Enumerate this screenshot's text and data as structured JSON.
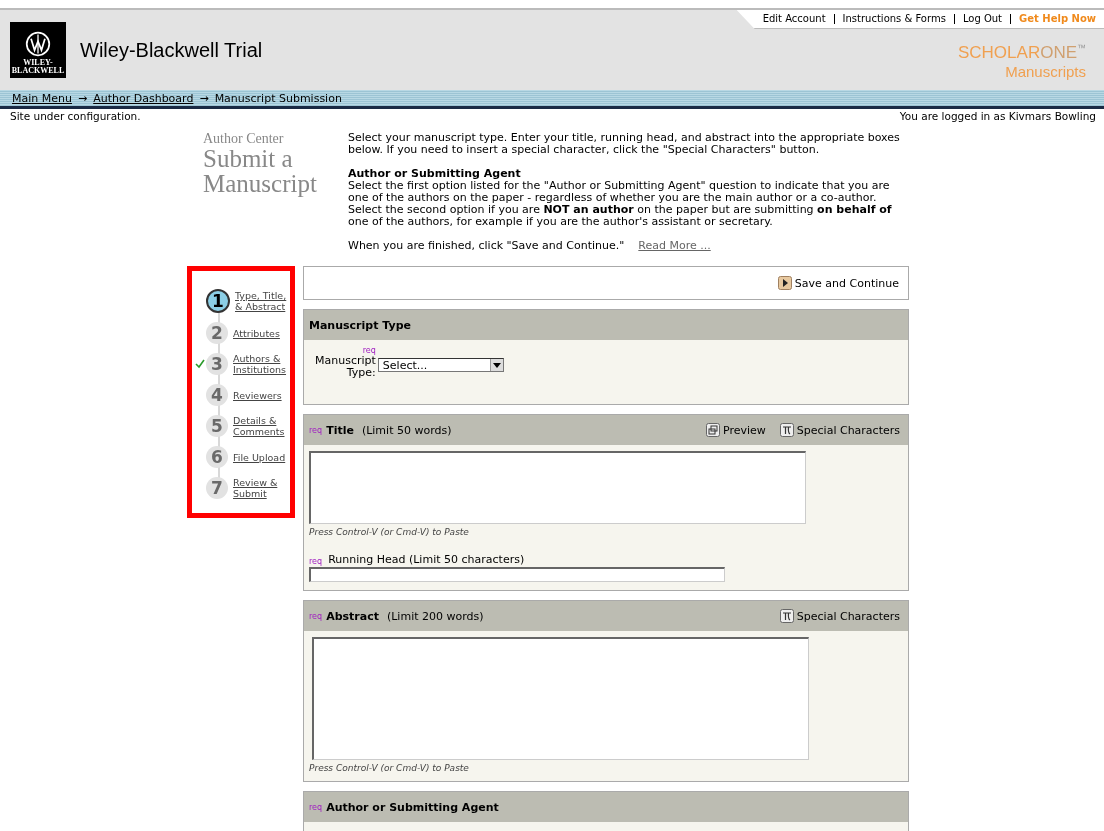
{
  "header": {
    "logo_lines": [
      "WILEY-",
      "BLACKWELL"
    ],
    "site_title": "Wiley-Blackwell Trial",
    "top_links": [
      {
        "label": "Edit Account",
        "kind": "normal"
      },
      {
        "label": "Instructions & Forms",
        "kind": "normal"
      },
      {
        "label": "Log Out",
        "kind": "normal"
      },
      {
        "label": "Get Help Now",
        "kind": "help"
      }
    ],
    "brand": {
      "part_a": "SCHOLAR",
      "part_b": "ONE",
      "tm": "™",
      "product": "Manuscripts"
    }
  },
  "breadcrumb": [
    {
      "label": "Main Menu",
      "link": true
    },
    {
      "label": "Author Dashboard",
      "link": true
    },
    {
      "label": "Manuscript Submission",
      "link": false
    }
  ],
  "breadcrumb_separator": "→",
  "status": {
    "left": "Site under configuration.",
    "right": "You are logged in as Kivmars Bowling"
  },
  "intro": {
    "kicker": "Author Center",
    "title_lines": [
      "Submit a",
      "Manuscript"
    ],
    "paragraph_1": "Select your manuscript type. Enter your title, running head, and abstract into the appropriate boxes below. If you need to insert a special character, click the \"Special Characters\" button.",
    "heading": "Author or Submitting Agent",
    "paragraph_2": "Select the first option listed for the \"Author or Submitting Agent\" question to indicate that you are one of the authors on the paper - regardless of whether you are the main author or a co-author. Select the second option if you are **NOT an author** on the paper but are submitting **on behalf of** one of the authors, for example if you are the author's assistant or secretary.",
    "paragraph_3": "When you are finished, click \"Save and Continue.\"",
    "read_more": "Read More ..."
  },
  "steps": [
    {
      "number": "1",
      "label_lines": [
        "Type, Title,",
        "& Abstract"
      ],
      "selected": true,
      "completed": false
    },
    {
      "number": "2",
      "label_lines": [
        "Attributes"
      ],
      "selected": false,
      "completed": false
    },
    {
      "number": "3",
      "label_lines": [
        "Authors &",
        "Institutions"
      ],
      "selected": false,
      "completed": true
    },
    {
      "number": "4",
      "label_lines": [
        "Reviewers"
      ],
      "selected": false,
      "completed": false
    },
    {
      "number": "5",
      "label_lines": [
        "Details &",
        "Comments"
      ],
      "selected": false,
      "completed": false
    },
    {
      "number": "6",
      "label_lines": [
        "File Upload"
      ],
      "selected": false,
      "completed": false
    },
    {
      "number": "7",
      "label_lines": [
        "Review &",
        "Submit"
      ],
      "selected": false,
      "completed": false
    }
  ],
  "save_button": "Save and Continue",
  "sections": [
    {
      "kind": "select",
      "title": "Manuscript Type",
      "req": "req",
      "field_label_lines": [
        "Manuscript",
        "Type:"
      ],
      "select_value": "Select..."
    },
    {
      "kind": "title",
      "req": "req",
      "title": "Title",
      "limit": "(Limit 50 words)",
      "actions": [
        "Preview",
        "Special Characters"
      ],
      "paste_hint": "Press Control-V (or Cmd-V) to Paste",
      "sub_req": "req",
      "sub_label": "Running Head  (Limit 50 characters)"
    },
    {
      "kind": "abstract",
      "req": "req",
      "title": "Abstract",
      "limit": "(Limit 200 words)",
      "actions": [
        "Special Characters"
      ],
      "paste_hint": "Press Control-V (or Cmd-V) to Paste"
    },
    {
      "kind": "agent",
      "req": "req",
      "title": "Author or Submitting Agent"
    }
  ]
}
